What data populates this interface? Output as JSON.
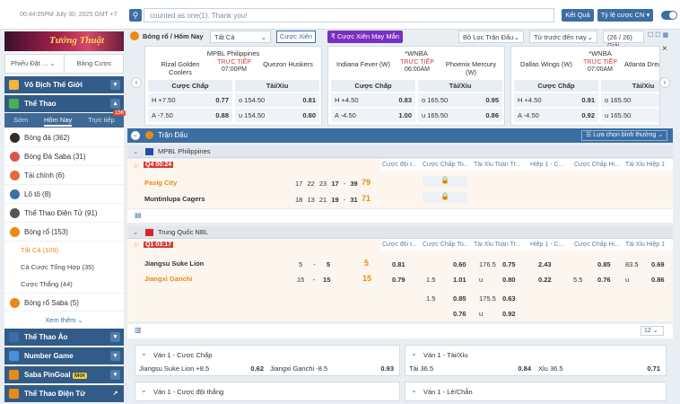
{
  "topbar": {
    "datetime": "00:44:05PM July 30, 2025 GMT +7",
    "search_icon": "search-icon",
    "message": "counted as one(1). Thank you!",
    "results_button": "Kết Quả",
    "odds_button": "Tỷ lệ cược CN",
    "odds_arrow": "▾"
  },
  "sidebar": {
    "tabs": [
      "Phiếu Đặt ...",
      "Bảng Cược"
    ],
    "sections": {
      "world_champ": "Vô Địch Thế Giới",
      "sports": "Thể Thao",
      "virtual": "Thể Thao Ảo",
      "number_game": "Number Game",
      "pingoal": "Saba PinGoal",
      "pingoal_badge": "Mới",
      "esports": "Thể Thao Điện Tử"
    },
    "subtabs": [
      "Sớm",
      "Hôm Nay",
      "Trực tiếp"
    ],
    "live_badge": "156",
    "items": [
      {
        "label": "Bóng đá",
        "count": "(362)",
        "color": "#2e2e2e"
      },
      {
        "label": "Bóng Đá Saba",
        "count": "(31)",
        "color": "#d9534f"
      },
      {
        "label": "Tài chính",
        "count": "(6)",
        "color": "#e26b3a"
      },
      {
        "label": "Lô tô",
        "count": "(8)",
        "color": "#3b6ea5"
      },
      {
        "label": "Thể Thao Điện Tử",
        "count": "(91)",
        "color": "#555"
      },
      {
        "label": "Bóng rổ",
        "count": "(153)",
        "color": "#e98a14"
      }
    ],
    "sub": [
      {
        "label": "Tất Cả",
        "count": "(109)"
      },
      {
        "label": "Cả Cược Tổng Hợp",
        "count": "(35)"
      },
      {
        "label": "Cược Thắng",
        "count": "(44)"
      }
    ],
    "saba_bb": {
      "label": "Bóng rổ Saba",
      "count": "(5)"
    },
    "more": "Xem thêm"
  },
  "filters": {
    "crumb": "Bóng rổ / Hôm Nay",
    "type": "Tất Cả",
    "parlay": "Cược Xiên",
    "lucky": "₹ Cược Xiên May Mắn",
    "league_filter": "Bộ Lọc Trận Đấu",
    "time_filter": "Từ trước đến nay",
    "pages": "(26 / 26)",
    "tier": "Giải"
  },
  "cards": [
    {
      "league": "MPBL Philippines",
      "teamA": "Rizal Golden Coolers",
      "live": "TRỰC TIẾP",
      "time": "07:00PM",
      "teamB": "Quezon Huskers",
      "h1": "H",
      "h1v": "+7.50",
      "h1o": "0.77",
      "h2": "A",
      "h2v": "-7.50",
      "h2o": "0.88",
      "o": "o",
      "ov": "154.50",
      "oo": "0.81",
      "u": "u",
      "uv": "154.50",
      "uo": "0.80"
    },
    {
      "league": "*WNBA",
      "teamA": "Indiana Fever (W)",
      "live": "TRỰC TIẾP",
      "time": "06:00AM",
      "teamB": "Phoenix Mercury (W)",
      "h1": "H",
      "h1v": "+4.50",
      "h1o": "0.83",
      "h2": "A",
      "h2v": "-4.50",
      "h2o": "1.00",
      "o": "o",
      "ov": "165.50",
      "oo": "0.95",
      "u": "u",
      "uv": "165.50",
      "uo": "0.86"
    },
    {
      "league": "*WNBA",
      "teamA": "Dallas Wings (W)",
      "live": "TRỰC TIẾP",
      "time": "07:00AM",
      "teamB": "Atlanta Dream",
      "h1": "H",
      "h1v": "+4.50",
      "h1o": "0.91",
      "h2": "A",
      "h2v": "-4.50",
      "h2o": "0.92",
      "o": "o",
      "ov": "165.50",
      "oo": "",
      "u": "u",
      "uv": "165.50",
      "uo": ""
    }
  ],
  "card_headers": {
    "hcp": "Cược Chấp",
    "ou": "Tài/Xỉu"
  },
  "section": {
    "title": "Trận Đấu",
    "sort": "Lựa chọn bình thường"
  },
  "league1": {
    "name": "MPBL Philippines",
    "status": "Q4",
    "clock": "00:24",
    "home": "Pasig City",
    "away": "Muntinlupa Cagers",
    "home_q": [
      "17",
      "22",
      "23",
      "17",
      "-",
      "39"
    ],
    "home_total": "79",
    "away_q": [
      "18",
      "13",
      "21",
      "19",
      "-",
      "31"
    ],
    "away_total": "71"
  },
  "columns": [
    "Cược đội t...",
    "Cược Chấp To...",
    "Tài Xỉu Toàn Tr...",
    "Hiệp 1 - C...",
    "Cược Chấp Hi...",
    "Tài Xỉu Hiệp 1"
  ],
  "league2": {
    "name": "Trung Quốc NBL",
    "status": "Q1",
    "clock": "03:17",
    "home": "Jiangsu Suke Lion",
    "away": "Jiangxi Ganchi",
    "home_q": [
      "5",
      "-",
      "5"
    ],
    "home_total": "5",
    "away_q": [
      "15",
      "-",
      "15"
    ],
    "away_total": "15",
    "r1": [
      "0.81",
      "0.60",
      "176.5",
      "0.75",
      "2.43",
      "0.85",
      "83.5",
      "0.69"
    ],
    "r2": [
      "0.79",
      "1.5",
      "1.01",
      "u",
      "0.80",
      "0.22",
      "5.5",
      "0.76",
      "u",
      "0.86"
    ],
    "r3": [
      "1.5",
      "0.85",
      "175.5",
      "0.63"
    ],
    "r4": [
      "0.76",
      "u",
      "0.92"
    ]
  },
  "pager": "12",
  "bottom": {
    "p1_title": "Ván 1 - Cược Chấp",
    "p1_a": "Jiangsu Suke Lion",
    "p1_av": "+8.5",
    "p1_ao": "0.62",
    "p1_b": "Jiangxi Ganchi",
    "p1_bv": "-8.5",
    "p1_bo": "0.93",
    "p2_title": "Ván 1 - Tài/Xỉu",
    "p2_a": "Tài",
    "p2_av": "36.5",
    "p2_ao": "0.84",
    "p2_b": "Xỉu",
    "p2_bv": "36.5",
    "p2_bo": "0.71",
    "p3_title": "Ván 1 - Cược đội thắng",
    "p4_title": "Ván 1 - Lẻ/Chẵn"
  }
}
